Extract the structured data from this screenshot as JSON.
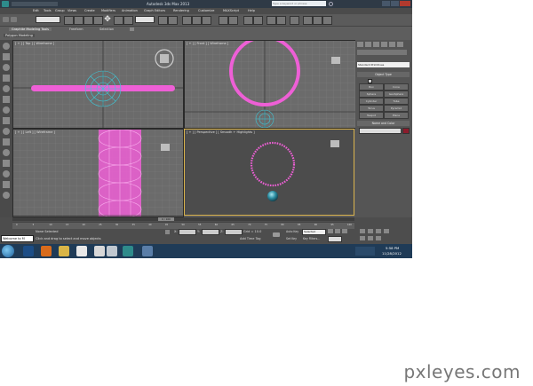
{
  "window": {
    "title": "Autodesk 3ds Max 2013",
    "search_placeholder": "Type a keyword or phrase"
  },
  "menu": [
    "Edit",
    "Tools",
    "Group",
    "Views",
    "Create",
    "Modifiers",
    "Animation",
    "Graph Editors",
    "Rendering",
    "Customize",
    "MAXScript",
    "Help"
  ],
  "ribbon": {
    "tabs": [
      "Graphite Modeling Tools",
      "Freeform",
      "Selection"
    ],
    "subtab": "Polygon Modeling"
  },
  "viewports": {
    "top": "[ + ] [ Top ] [ Wireframe ]",
    "front": "[ + ] [ Front ] [ Wireframe ]",
    "left": "[ + ] [ Left ] [ Wireframe ]",
    "perspective": "[ + ] [ Perspective ] [ Smooth + Highlights ]"
  },
  "command_panel": {
    "dropdown": "Standard Primitives",
    "object_type_title": "Object Type",
    "buttons": [
      "Box",
      "Cone",
      "Sphere",
      "GeoSphere",
      "Cylinder",
      "Tube",
      "Torus",
      "Pyramid",
      "Teapot",
      "Plane"
    ],
    "name_color_title": "Name and Color"
  },
  "timeline": {
    "frame": "0 / 100",
    "ticks": [
      "0",
      "5",
      "10",
      "15",
      "20",
      "25",
      "30",
      "35",
      "40",
      "45",
      "50",
      "55",
      "60",
      "65",
      "70",
      "75",
      "80",
      "85",
      "90",
      "95",
      "100"
    ]
  },
  "status": {
    "maxscript": "Welcome to M",
    "selection": "None Selected",
    "prompt": "Click and drag to select and move objects",
    "x_label": "X:",
    "y_label": "Y:",
    "z_label": "Z:",
    "grid": "Grid = 10.0",
    "add_time_tag": "Add Time Tag",
    "auto_key": "Auto Key",
    "selected": "Selected",
    "set_key": "Set Key",
    "key_filters": "Key Filters..."
  },
  "taskbar": {
    "time": "5:58 PM",
    "date": "11/28/2012"
  },
  "watermark": "pxleyes.com",
  "colors": {
    "pink": "#ee5fd6",
    "cyan": "#3fc6d6",
    "viewport": "#6b6b6b",
    "perspective_bg": "#4c4c4c"
  }
}
